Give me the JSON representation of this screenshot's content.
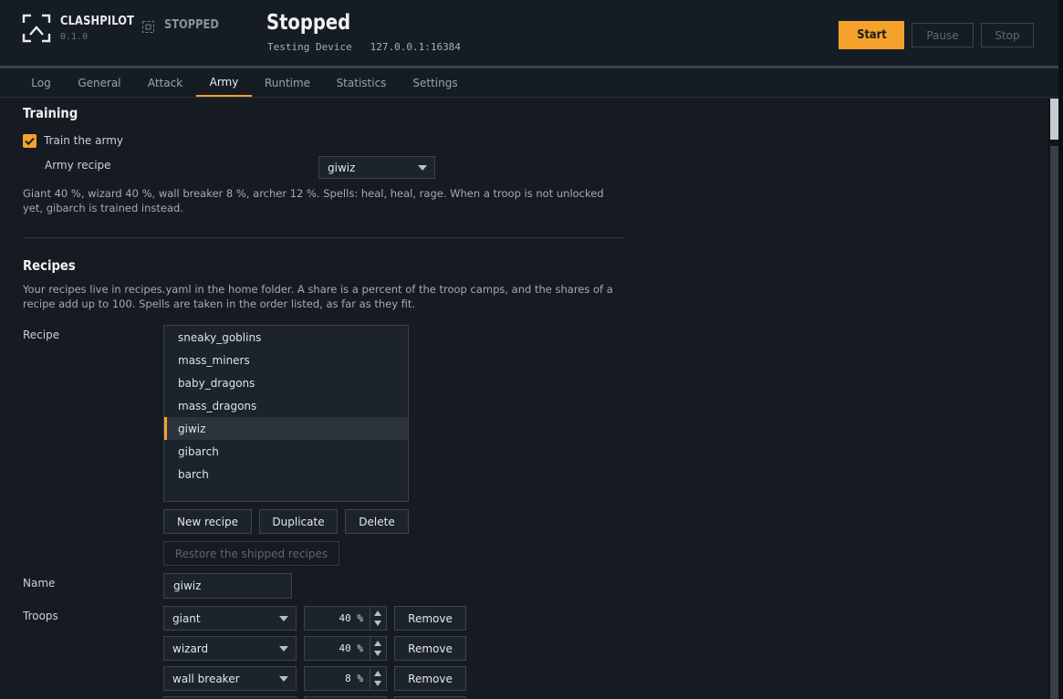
{
  "app": {
    "name": "CLASHPILOT",
    "version": "0.1.0",
    "status": "STOPPED",
    "state_title": "Stopped",
    "device_name": "Testing Device",
    "device_address": "127.0.0.1:16384"
  },
  "controls": {
    "start": "Start",
    "pause": "Pause",
    "stop": "Stop"
  },
  "tabs": [
    {
      "label": "Log"
    },
    {
      "label": "General"
    },
    {
      "label": "Attack"
    },
    {
      "label": "Army",
      "active": true
    },
    {
      "label": "Runtime"
    },
    {
      "label": "Statistics"
    },
    {
      "label": "Settings"
    }
  ],
  "training": {
    "title": "Training",
    "train_label": "Train the army",
    "train_checked": true,
    "recipe_label": "Army recipe",
    "recipe_value": "giwiz",
    "description": "Giant 40 %, wizard 40 %, wall breaker 8 %, archer 12 %. Spells: heal, heal, rage. When a troop is not unlocked yet, gibarch is trained instead."
  },
  "recipes": {
    "title": "Recipes",
    "description": "Your recipes live in recipes.yaml in the home folder. A share is a percent of the troop camps, and the shares of a recipe add up to 100. Spells are taken in the order listed, as far as they fit.",
    "list_label": "Recipe",
    "items": [
      "sneaky_goblins",
      "mass_miners",
      "baby_dragons",
      "mass_dragons",
      "giwiz",
      "gibarch",
      "barch"
    ],
    "selected": "giwiz",
    "new_label": "New recipe",
    "duplicate_label": "Duplicate",
    "delete_label": "Delete",
    "restore_label": "Restore the shipped recipes",
    "name_label": "Name",
    "name_value": "giwiz",
    "troops_label": "Troops",
    "troops": [
      {
        "troop": "giant",
        "share": "40 %",
        "remove": "Remove"
      },
      {
        "troop": "wizard",
        "share": "40 %",
        "remove": "Remove"
      },
      {
        "troop": "wall breaker",
        "share": "8 %",
        "remove": "Remove"
      }
    ]
  },
  "colors": {
    "accent": "#f5a22c",
    "background": "#161b22",
    "panel": "#1c232c"
  }
}
